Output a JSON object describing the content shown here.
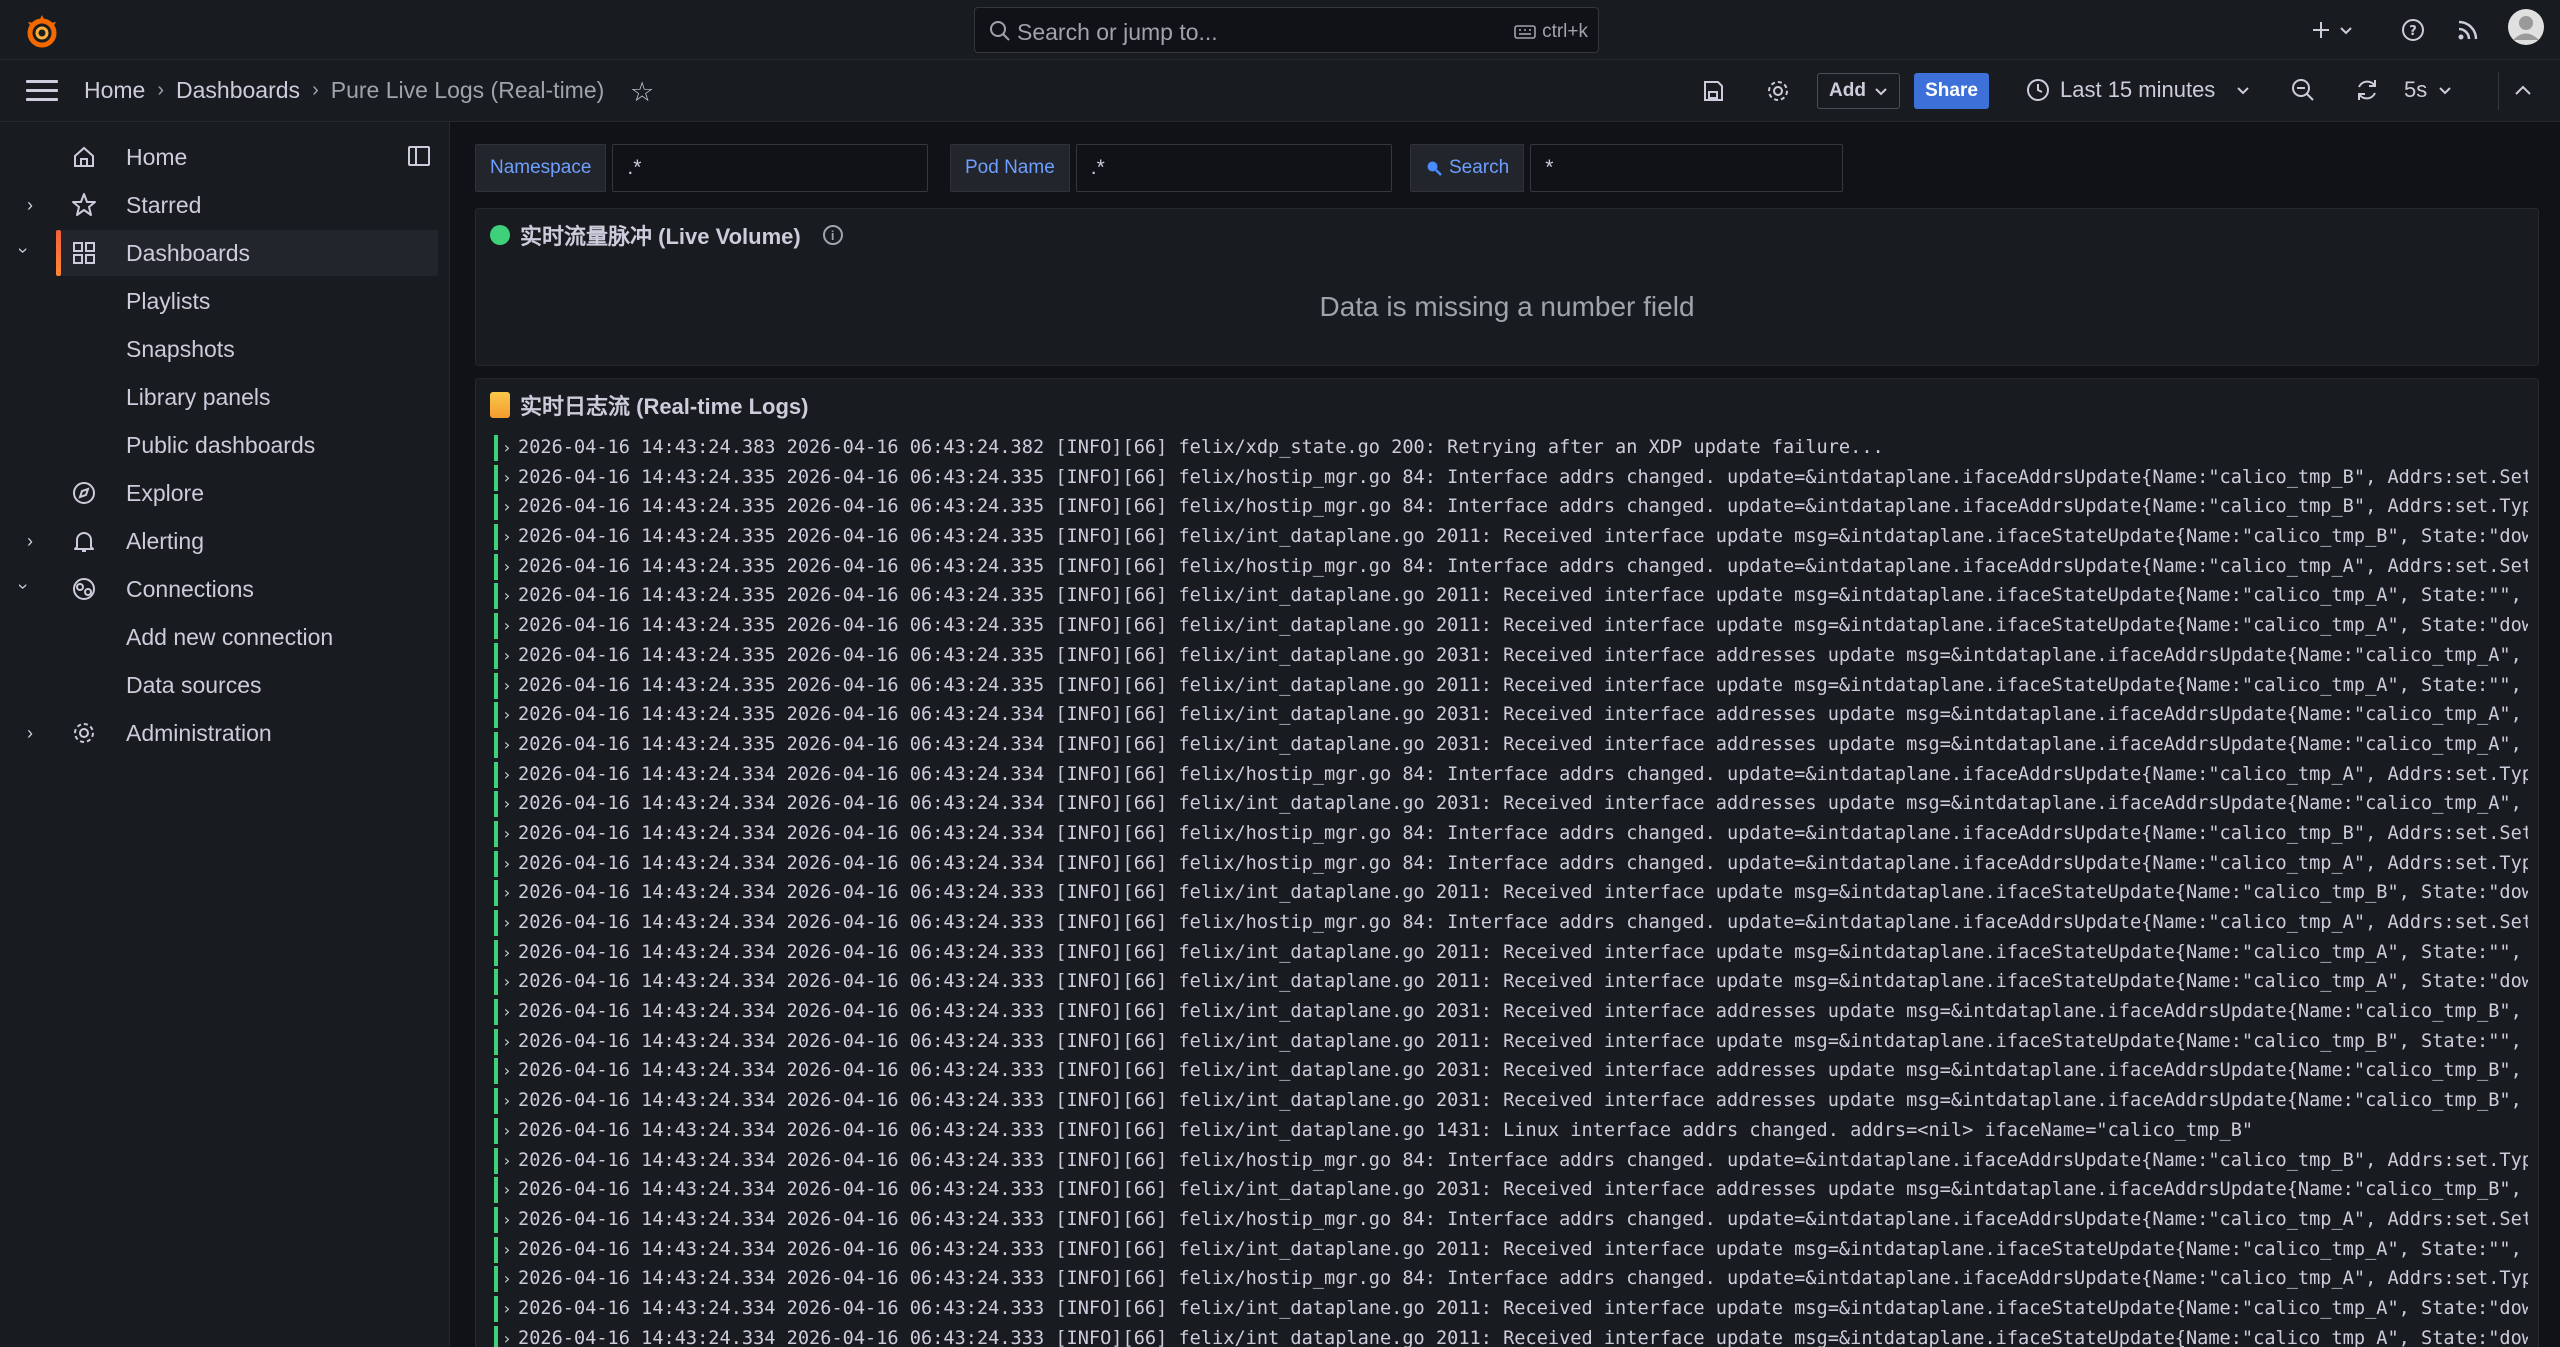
{
  "topbar": {
    "search_placeholder": "Search or jump to...",
    "search_shortcut": "ctrl+k"
  },
  "navbar": {
    "breadcrumbs": [
      "Home",
      "Dashboards",
      "Pure Live Logs (Real-time)"
    ],
    "add_label": "Add",
    "share_label": "Share",
    "time_range": "Last 15 minutes",
    "refresh_interval": "5s"
  },
  "sidebar": {
    "items": [
      {
        "label": "Home"
      },
      {
        "label": "Starred"
      },
      {
        "label": "Dashboards"
      },
      {
        "label": "Playlists"
      },
      {
        "label": "Snapshots"
      },
      {
        "label": "Library panels"
      },
      {
        "label": "Public dashboards"
      },
      {
        "label": "Explore"
      },
      {
        "label": "Alerting"
      },
      {
        "label": "Connections"
      },
      {
        "label": "Add new connection"
      },
      {
        "label": "Data sources"
      },
      {
        "label": "Administration"
      }
    ]
  },
  "variables": {
    "namespace": {
      "label": "Namespace",
      "value": ".*"
    },
    "pod_name": {
      "label": "Pod Name",
      "value": ".*"
    },
    "search": {
      "label": "Search",
      "value": "*"
    }
  },
  "panels": {
    "volume": {
      "title": "实时流量脉冲 (Live Volume)",
      "message": "Data is missing a number field"
    },
    "logs": {
      "title": "实时日志流 (Real-time Logs)"
    }
  },
  "logs": [
    "2026-04-16 14:43:24.383 2026-04-16 06:43:24.382 [INFO][66] felix/xdp_state.go 200: Retrying after an XDP update failure...",
    "2026-04-16 14:43:24.335 2026-04-16 06:43:24.335 [INFO][66] felix/hostip_mgr.go 84: Interface addrs changed. update=&intdataplane.ifaceAddrsUpdate{Name:\"calico_tmp_B\", Addrs:set.Set[s",
    "2026-04-16 14:43:24.335 2026-04-16 06:43:24.335 [INFO][66] felix/hostip_mgr.go 84: Interface addrs changed. update=&intdataplane.ifaceAddrsUpdate{Name:\"calico_tmp_B\", Addrs:set.Typed",
    "2026-04-16 14:43:24.335 2026-04-16 06:43:24.335 [INFO][66] felix/int_dataplane.go 2011: Received interface update msg=&intdataplane.ifaceStateUpdate{Name:\"calico_tmp_B\", State:\"down\"",
    "2026-04-16 14:43:24.335 2026-04-16 06:43:24.335 [INFO][66] felix/hostip_mgr.go 84: Interface addrs changed. update=&intdataplane.ifaceAddrsUpdate{Name:\"calico_tmp_A\", Addrs:set.Set[s",
    "2026-04-16 14:43:24.335 2026-04-16 06:43:24.335 [INFO][66] felix/int_dataplane.go 2011: Received interface update msg=&intdataplane.ifaceStateUpdate{Name:\"calico_tmp_A\", State:\"\", Ir",
    "2026-04-16 14:43:24.335 2026-04-16 06:43:24.335 [INFO][66] felix/int_dataplane.go 2011: Received interface update msg=&intdataplane.ifaceStateUpdate{Name:\"calico_tmp_A\", State:\"down\"",
    "2026-04-16 14:43:24.335 2026-04-16 06:43:24.335 [INFO][66] felix/int_dataplane.go 2031: Received interface addresses update msg=&intdataplane.ifaceAddrsUpdate{Name:\"calico_tmp_A\", Ac",
    "2026-04-16 14:43:24.335 2026-04-16 06:43:24.335 [INFO][66] felix/int_dataplane.go 2011: Received interface update msg=&intdataplane.ifaceStateUpdate{Name:\"calico_tmp_A\", State:\"\", Ir",
    "2026-04-16 14:43:24.335 2026-04-16 06:43:24.334 [INFO][66] felix/int_dataplane.go 2031: Received interface addresses update msg=&intdataplane.ifaceAddrsUpdate{Name:\"calico_tmp_A\", Ac",
    "2026-04-16 14:43:24.335 2026-04-16 06:43:24.334 [INFO][66] felix/int_dataplane.go 2031: Received interface addresses update msg=&intdataplane.ifaceAddrsUpdate{Name:\"calico_tmp_A\", Ac",
    "2026-04-16 14:43:24.334 2026-04-16 06:43:24.334 [INFO][66] felix/hostip_mgr.go 84: Interface addrs changed. update=&intdataplane.ifaceAddrsUpdate{Name:\"calico_tmp_A\", Addrs:set.Typed",
    "2026-04-16 14:43:24.334 2026-04-16 06:43:24.334 [INFO][66] felix/int_dataplane.go 2031: Received interface addresses update msg=&intdataplane.ifaceAddrsUpdate{Name:\"calico_tmp_A\", Ac",
    "2026-04-16 14:43:24.334 2026-04-16 06:43:24.334 [INFO][66] felix/hostip_mgr.go 84: Interface addrs changed. update=&intdataplane.ifaceAddrsUpdate{Name:\"calico_tmp_B\", Addrs:set.Set[s",
    "2026-04-16 14:43:24.334 2026-04-16 06:43:24.334 [INFO][66] felix/hostip_mgr.go 84: Interface addrs changed. update=&intdataplane.ifaceAddrsUpdate{Name:\"calico_tmp_A\", Addrs:set.Typed",
    "2026-04-16 14:43:24.334 2026-04-16 06:43:24.333 [INFO][66] felix/int_dataplane.go 2011: Received interface update msg=&intdataplane.ifaceStateUpdate{Name:\"calico_tmp_B\", State:\"down\"",
    "2026-04-16 14:43:24.334 2026-04-16 06:43:24.333 [INFO][66] felix/hostip_mgr.go 84: Interface addrs changed. update=&intdataplane.ifaceAddrsUpdate{Name:\"calico_tmp_A\", Addrs:set.Set[s",
    "2026-04-16 14:43:24.334 2026-04-16 06:43:24.333 [INFO][66] felix/int_dataplane.go 2011: Received interface update msg=&intdataplane.ifaceStateUpdate{Name:\"calico_tmp_A\", State:\"\", Ir",
    "2026-04-16 14:43:24.334 2026-04-16 06:43:24.333 [INFO][66] felix/int_dataplane.go 2011: Received interface update msg=&intdataplane.ifaceStateUpdate{Name:\"calico_tmp_A\", State:\"down\"",
    "2026-04-16 14:43:24.334 2026-04-16 06:43:24.333 [INFO][66] felix/int_dataplane.go 2031: Received interface addresses update msg=&intdataplane.ifaceAddrsUpdate{Name:\"calico_tmp_B\", Ac",
    "2026-04-16 14:43:24.334 2026-04-16 06:43:24.333 [INFO][66] felix/int_dataplane.go 2011: Received interface update msg=&intdataplane.ifaceStateUpdate{Name:\"calico_tmp_B\", State:\"\", Ir",
    "2026-04-16 14:43:24.334 2026-04-16 06:43:24.333 [INFO][66] felix/int_dataplane.go 2031: Received interface addresses update msg=&intdataplane.ifaceAddrsUpdate{Name:\"calico_tmp_B\", Ac",
    "2026-04-16 14:43:24.334 2026-04-16 06:43:24.333 [INFO][66] felix/int_dataplane.go 2031: Received interface addresses update msg=&intdataplane.ifaceAddrsUpdate{Name:\"calico_tmp_B\", Ac",
    "2026-04-16 14:43:24.334 2026-04-16 06:43:24.333 [INFO][66] felix/int_dataplane.go 1431: Linux interface addrs changed. addrs=<nil> ifaceName=\"calico_tmp_B\"",
    "2026-04-16 14:43:24.334 2026-04-16 06:43:24.333 [INFO][66] felix/hostip_mgr.go 84: Interface addrs changed. update=&intdataplane.ifaceAddrsUpdate{Name:\"calico_tmp_B\", Addrs:set.Typed",
    "2026-04-16 14:43:24.334 2026-04-16 06:43:24.333 [INFO][66] felix/int_dataplane.go 2031: Received interface addresses update msg=&intdataplane.ifaceAddrsUpdate{Name:\"calico_tmp_B\", Ac",
    "2026-04-16 14:43:24.334 2026-04-16 06:43:24.333 [INFO][66] felix/hostip_mgr.go 84: Interface addrs changed. update=&intdataplane.ifaceAddrsUpdate{Name:\"calico_tmp_A\", Addrs:set.Set[s",
    "2026-04-16 14:43:24.334 2026-04-16 06:43:24.333 [INFO][66] felix/int_dataplane.go 2011: Received interface update msg=&intdataplane.ifaceStateUpdate{Name:\"calico_tmp_A\", State:\"\", Ir",
    "2026-04-16 14:43:24.334 2026-04-16 06:43:24.333 [INFO][66] felix/hostip_mgr.go 84: Interface addrs changed. update=&intdataplane.ifaceAddrsUpdate{Name:\"calico_tmp_A\", Addrs:set.Typed",
    "2026-04-16 14:43:24.334 2026-04-16 06:43:24.333 [INFO][66] felix/int_dataplane.go 2011: Received interface update msg=&intdataplane.ifaceStateUpdate{Name:\"calico_tmp_A\", State:\"down\"",
    "2026-04-16 14:43:24.334 2026-04-16 06:43:24.333 [INFO][66] felix/int_dataplane.go 2011: Received interface update msg=&intdataplane.ifaceStateUpdate{Name:\"calico_tmp_A\", State:\"down\""
  ]
}
